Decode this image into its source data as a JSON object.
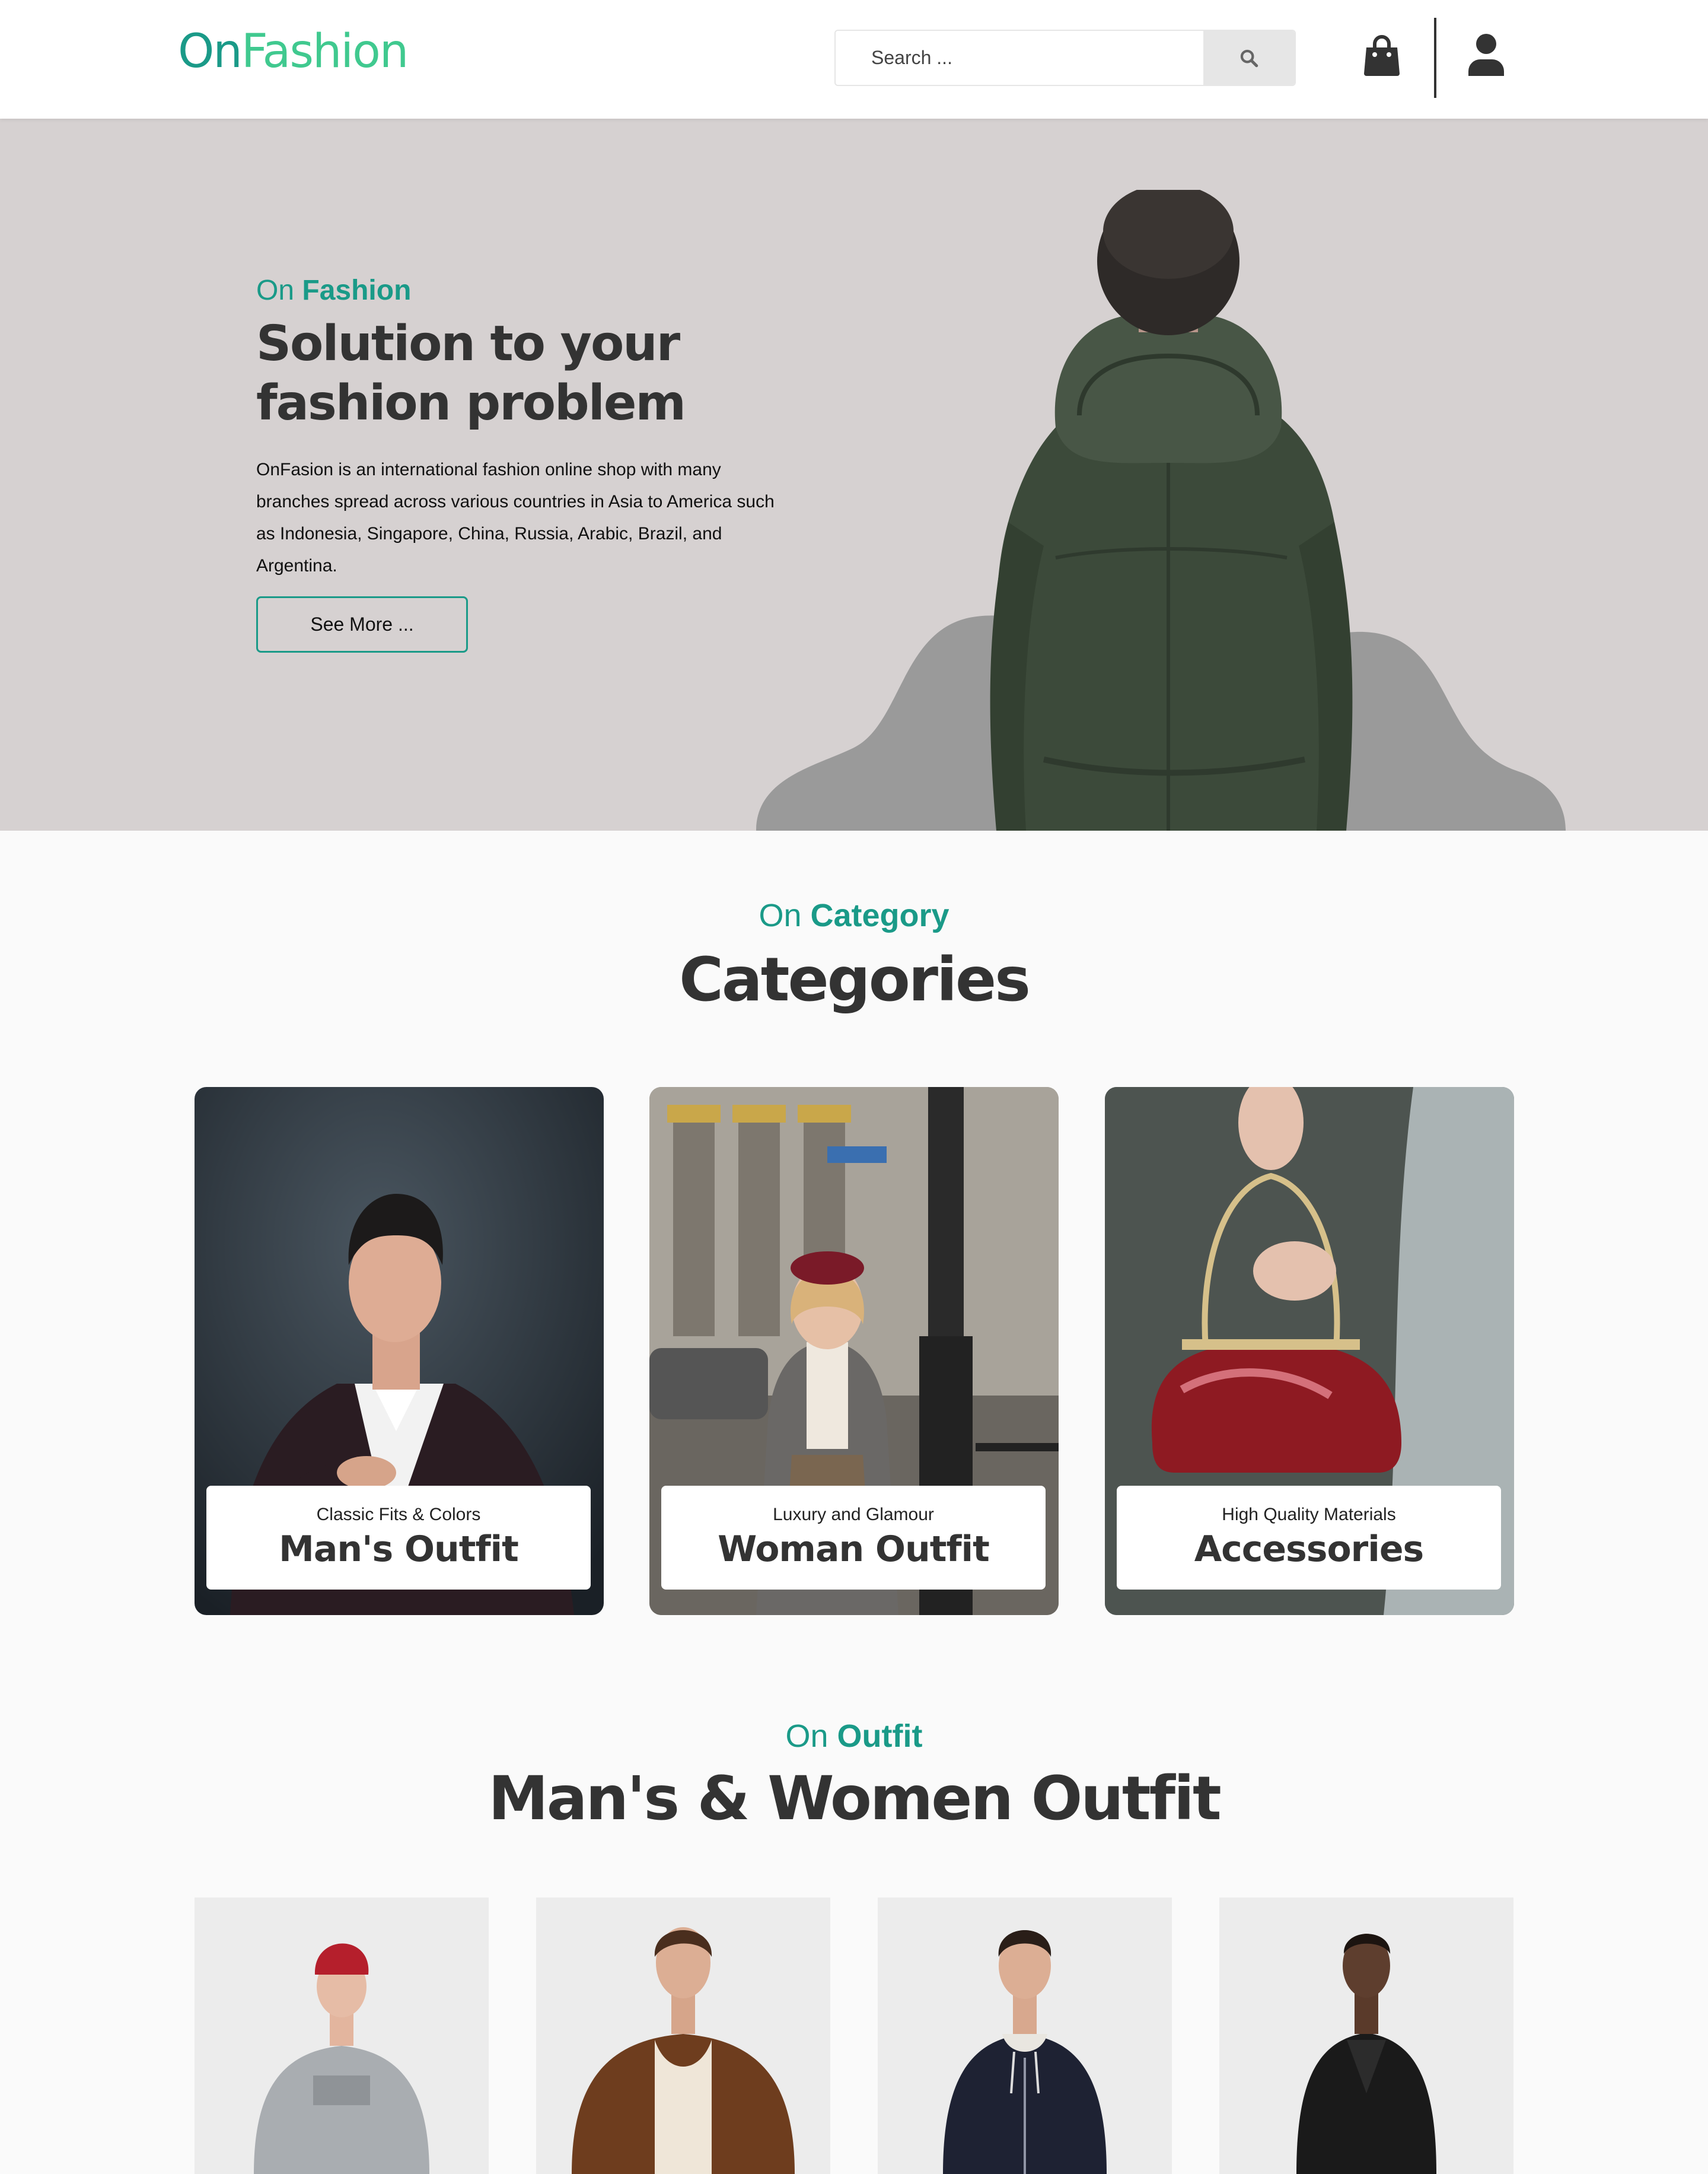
{
  "brand": {
    "part1": "On",
    "part2": "Fashion"
  },
  "search": {
    "placeholder": "Search ..."
  },
  "icons": {
    "search": "search-icon",
    "cart": "shopping-bag-icon",
    "account": "user-icon"
  },
  "colors": {
    "accent": "#1a9a88",
    "accent_light": "#40c98f",
    "hero_bg": "#d6d1d1",
    "text_dark": "#333333"
  },
  "hero": {
    "kicker_light": "On",
    "kicker_bold": "Fashion",
    "title": "Solution to your fashion problem",
    "description": "OnFasion is an international fashion online shop with many branches spread across various countries in Asia to America such as Indonesia, Singapore, China, Russia, Arabic, Brazil, and Argentina.",
    "button": "See More ..."
  },
  "categories_section": {
    "kicker_light": "On",
    "kicker_bold": "Category",
    "title": "Categories",
    "items": [
      {
        "subtitle": "Classic Fits & Colors",
        "name": "Man's Outfit"
      },
      {
        "subtitle": "Luxury and Glamour",
        "name": "Woman Outfit"
      },
      {
        "subtitle": "High Quality Materials",
        "name": "Accessories"
      }
    ]
  },
  "outfit_section": {
    "kicker_light": "On",
    "kicker_bold": "Outfit",
    "title": "Man's & Women Outfit"
  }
}
